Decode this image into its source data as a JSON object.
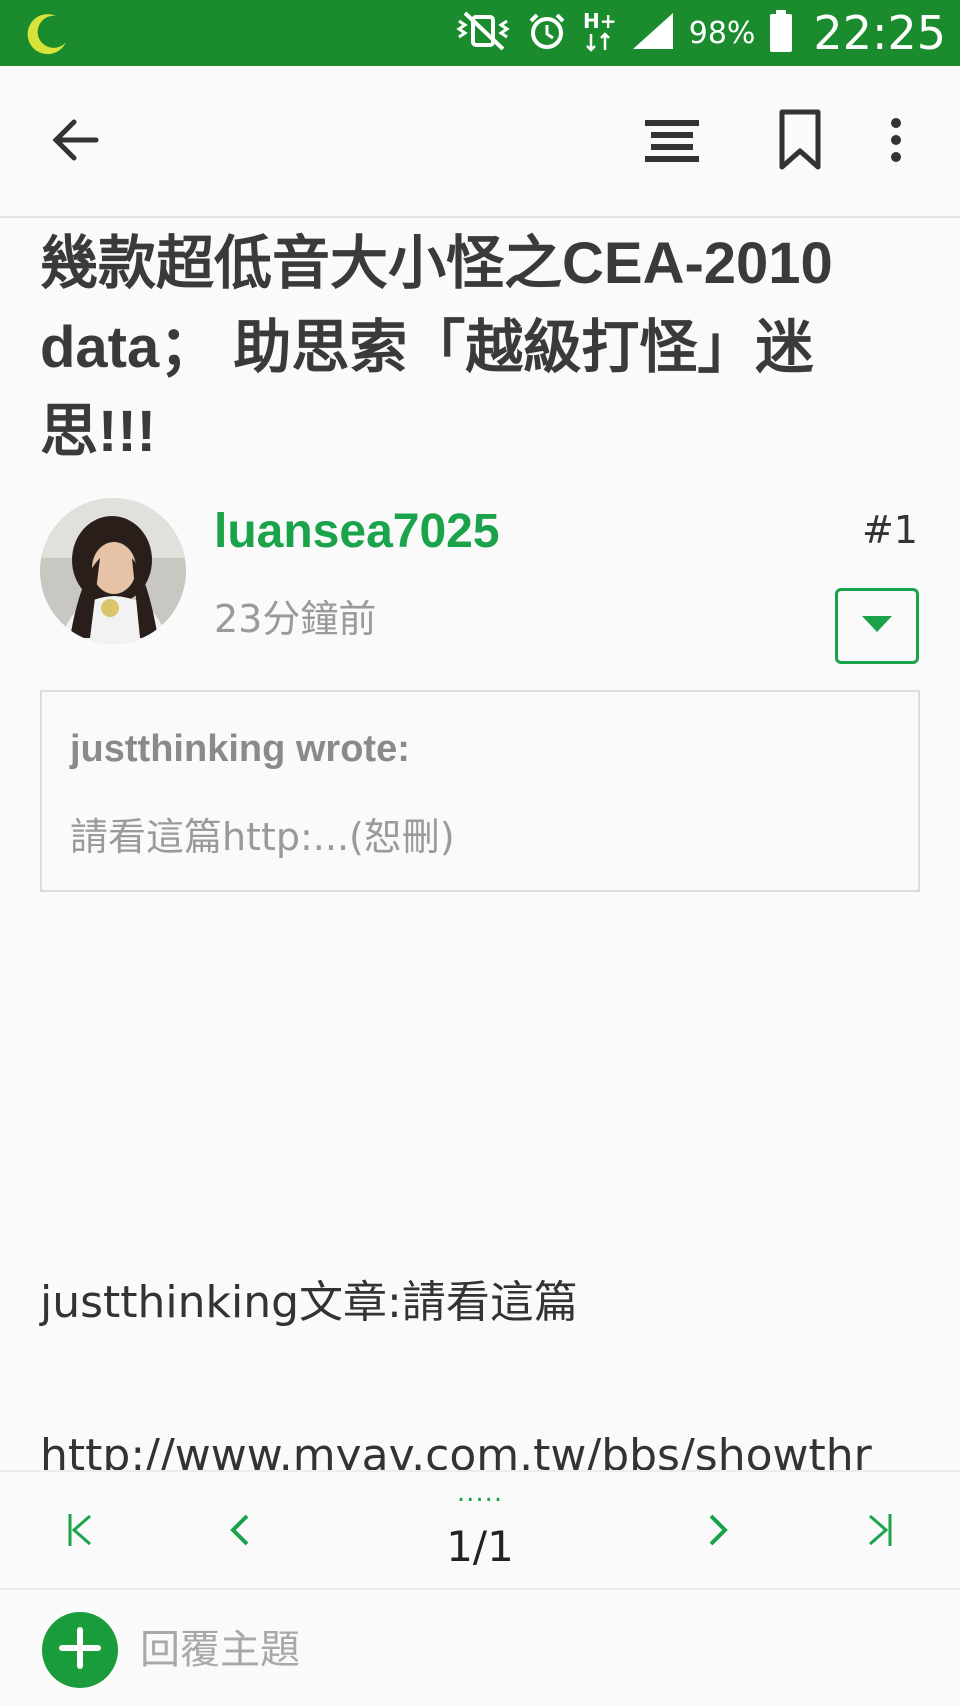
{
  "status_bar": {
    "battery": "98%",
    "time": "22:25",
    "network": "H+",
    "icons": [
      "moon-icon",
      "vibrate-mute-icon",
      "alarm-icon",
      "hplus-data-icon",
      "signal-icon",
      "battery-icon"
    ]
  },
  "app_bar": {
    "icons": [
      "back-arrow-icon",
      "list-icon",
      "bookmark-icon",
      "more-vert-icon"
    ]
  },
  "post": {
    "title": "幾款超低音大小怪之CEA-2010 data； 助思索「越級打怪」迷思!!!",
    "author": "luansea7025",
    "time": "23分鐘前",
    "number": "#1",
    "quote": {
      "author": "justthinking wrote:",
      "text": "請看這篇http:...(恕刪)"
    },
    "body": [
      "justthinking文章:請看這篇",
      "http://www.myav.com.tw/bbs/showthr"
    ]
  },
  "pager": {
    "dots": ".....",
    "page": "1/1"
  },
  "reply": {
    "placeholder": "回覆主題"
  },
  "colors": {
    "status_bar": "#1a8c2e",
    "accent": "#1aa34a",
    "title": "#3a3a3a"
  }
}
